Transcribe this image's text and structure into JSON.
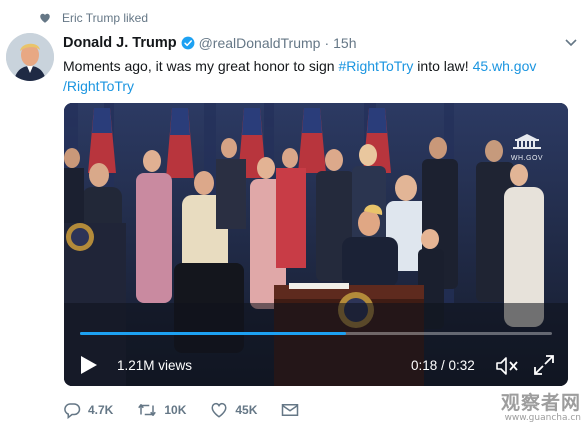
{
  "context": {
    "liked_by_text": "Eric Trump liked"
  },
  "tweet": {
    "display_name": "Donald J. Trump",
    "handle": "@realDonaldTrump",
    "separator": "·",
    "time": "15h",
    "text_before": "Moments ago, it was my great honor to sign ",
    "hashtag": "#RightToTry",
    "text_middle": " into law! ",
    "link_line1": "45.wh.gov",
    "link_line2": "/RightToTry"
  },
  "media": {
    "watermark_text": "WH.GOV",
    "views": "1.21M views",
    "duration": "0:18 / 0:32",
    "progress": 0.5625
  },
  "actions": {
    "replies": "4.7K",
    "retweets": "10K",
    "likes": "45K"
  },
  "site_watermark": {
    "main": "观察者网",
    "url": "www.guancha.cn"
  },
  "colors": {
    "link": "#1b95e0",
    "verified": "#1da1f2",
    "secondary_text": "#657786",
    "progress": "#1da1f2"
  }
}
